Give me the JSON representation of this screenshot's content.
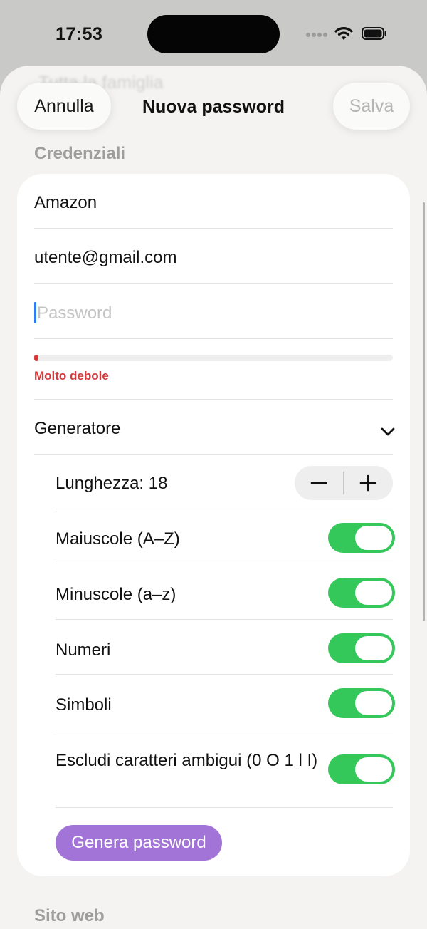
{
  "status_bar": {
    "time": "17:53"
  },
  "background_title": "Tutta la famiglia",
  "nav": {
    "cancel_label": "Annulla",
    "title": "Nuova password",
    "save_label": "Salva"
  },
  "credentials": {
    "section_title": "Credenziali",
    "service_name": "Amazon",
    "username": "utente@gmail.com",
    "password_placeholder": "Password",
    "password_value": "",
    "strength": {
      "label": "Molto debole",
      "level": 0.01,
      "color": "#d23a3a"
    }
  },
  "generator": {
    "title": "Generatore",
    "expanded": true,
    "length_label": "Lunghezza: 18",
    "length_value": 18,
    "options": [
      {
        "label": "Maiuscole (A–Z)",
        "enabled": true
      },
      {
        "label": "Minuscole (a–z)",
        "enabled": true
      },
      {
        "label": "Numeri",
        "enabled": true
      },
      {
        "label": "Simboli",
        "enabled": true
      },
      {
        "label": "Escludi caratteri ambigui (0 O 1 l I)",
        "enabled": true
      }
    ],
    "generate_label": "Genera password"
  },
  "website": {
    "section_title": "Sito web"
  },
  "colors": {
    "accent": "#a274d8",
    "toggle_on": "#34c759",
    "caret": "#2f7cf6",
    "weak": "#d23a3a"
  }
}
